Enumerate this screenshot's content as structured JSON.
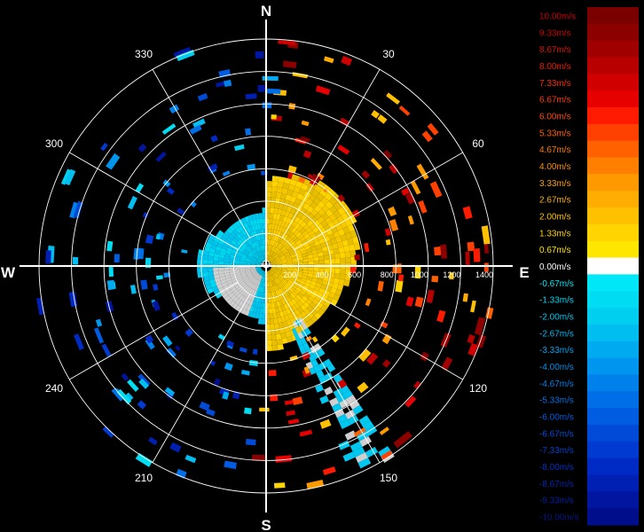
{
  "chart_data": {
    "type": "polar-heatmap",
    "title": "",
    "compass": {
      "north": "N",
      "east": "E",
      "south": "S",
      "west": "W"
    },
    "bearing_labels": [
      "30",
      "60",
      "120",
      "150",
      "210",
      "240",
      "300",
      "330"
    ],
    "bearings_deg": [
      30,
      60,
      120,
      150,
      210,
      240,
      300,
      330
    ],
    "range_ticks": [
      "200",
      "400",
      "600",
      "800",
      "1000",
      "1200",
      "1400"
    ],
    "range_values": [
      200,
      400,
      600,
      800,
      1000,
      1200,
      1400
    ],
    "range_max": 1400,
    "colorbar": {
      "labels": [
        "10.00m/s",
        "9.33m/s",
        "8.67m/s",
        "8.00m/s",
        "7.33m/s",
        "6.67m/s",
        "6.00m/s",
        "5.33m/s",
        "4.67m/s",
        "4.00m/s",
        "3.33m/s",
        "2.67m/s",
        "2.00m/s",
        "1.33m/s",
        "0.67m/s",
        "0.00m/s",
        "-0.67m/s",
        "-1.33m/s",
        "-2.00m/s",
        "-2.67m/s",
        "-3.33m/s",
        "-4.00m/s",
        "-4.67m/s",
        "-5.33m/s",
        "-6.00m/s",
        "-6.67m/s",
        "-7.33m/s",
        "-8.00m/s",
        "-8.67m/s",
        "-9.33m/s",
        "-10.00m/s"
      ],
      "values": [
        10.0,
        9.33,
        8.67,
        8.0,
        7.33,
        6.67,
        6.0,
        5.33,
        4.67,
        4.0,
        3.33,
        2.67,
        2.0,
        1.33,
        0.67,
        0.0,
        -0.67,
        -1.33,
        -2.0,
        -2.67,
        -3.33,
        -4.0,
        -4.67,
        -5.33,
        -6.0,
        -6.67,
        -7.33,
        -8.0,
        -8.67,
        -9.33,
        -10.0
      ],
      "colors": [
        "#7a0000",
        "#8c0000",
        "#a00000",
        "#b80000",
        "#d00000",
        "#e60000",
        "#ff1a00",
        "#ff4000",
        "#ff6000",
        "#ff8000",
        "#ff9900",
        "#ffad00",
        "#ffc000",
        "#ffd400",
        "#ffe600",
        "#ffffff",
        "#00e8f8",
        "#00dcf2",
        "#00cff0",
        "#00bff0",
        "#00aaf0",
        "#0095ee",
        "#0080ea",
        "#006ee6",
        "#005ce0",
        "#004ad8",
        "#003ad0",
        "#002ac4",
        "#0020b4",
        "#0016a0",
        "#000e8c"
      ],
      "label_colors": [
        "#cc0000",
        "#cc0000",
        "#dd1100",
        "#ee1a00",
        "#ff2a00",
        "#ff3a00",
        "#ff4a00",
        "#ff6000",
        "#ff7a00",
        "#ff9000",
        "#ffa000",
        "#ffb000",
        "#ffc400",
        "#ffd400",
        "#ffe400",
        "#ffffff",
        "#00e8f8",
        "#00d8f2",
        "#00c8f0",
        "#00b8ee",
        "#00a4ee",
        "#0090ec",
        "#0080e8",
        "#0070e4",
        "#005ee0",
        "#004ed8",
        "#0040cc",
        "#0032c0",
        "#0028b0",
        "#00209c",
        "#001888"
      ]
    }
  }
}
